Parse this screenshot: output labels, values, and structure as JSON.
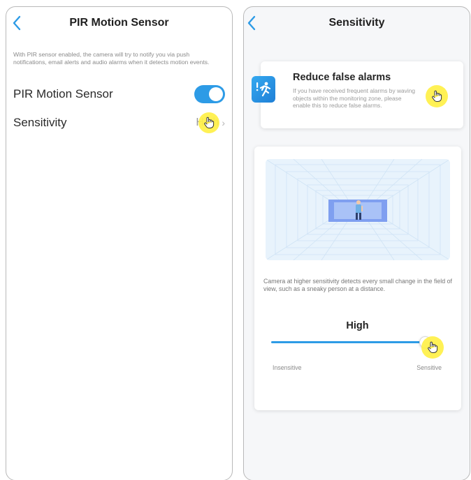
{
  "left_screen": {
    "title": "PIR Motion Sensor",
    "description": "With PIR sensor enabled, the camera will try to notify you via push notifications, email alerts and audio alarms when it detects motion events.",
    "pir_label": "PIR Motion Sensor",
    "pir_enabled": true,
    "sensitivity_label": "Sensitivity",
    "sensitivity_value": "High"
  },
  "right_screen": {
    "title": "Sensitivity",
    "alarm_card": {
      "title": "Reduce false alarms",
      "description": "If you have received frequent alarms by waving objects within the monitoring zone, please enable this to reduce false alarms."
    },
    "sensitivity_description": "Camera at higher sensitivity detects every small change in the field of view, such as a sneaky person at a distance.",
    "level_label": "High",
    "slider_value_fraction": 1.0,
    "min_label": "Insensitive",
    "max_label": "Sensitive"
  },
  "colors": {
    "accent": "#2d9be6",
    "highlight": "#fff046"
  },
  "icons": [
    "back-chevron-icon",
    "chevron-right-icon",
    "running-person-alarm-icon",
    "pointer-hand-icon"
  ]
}
